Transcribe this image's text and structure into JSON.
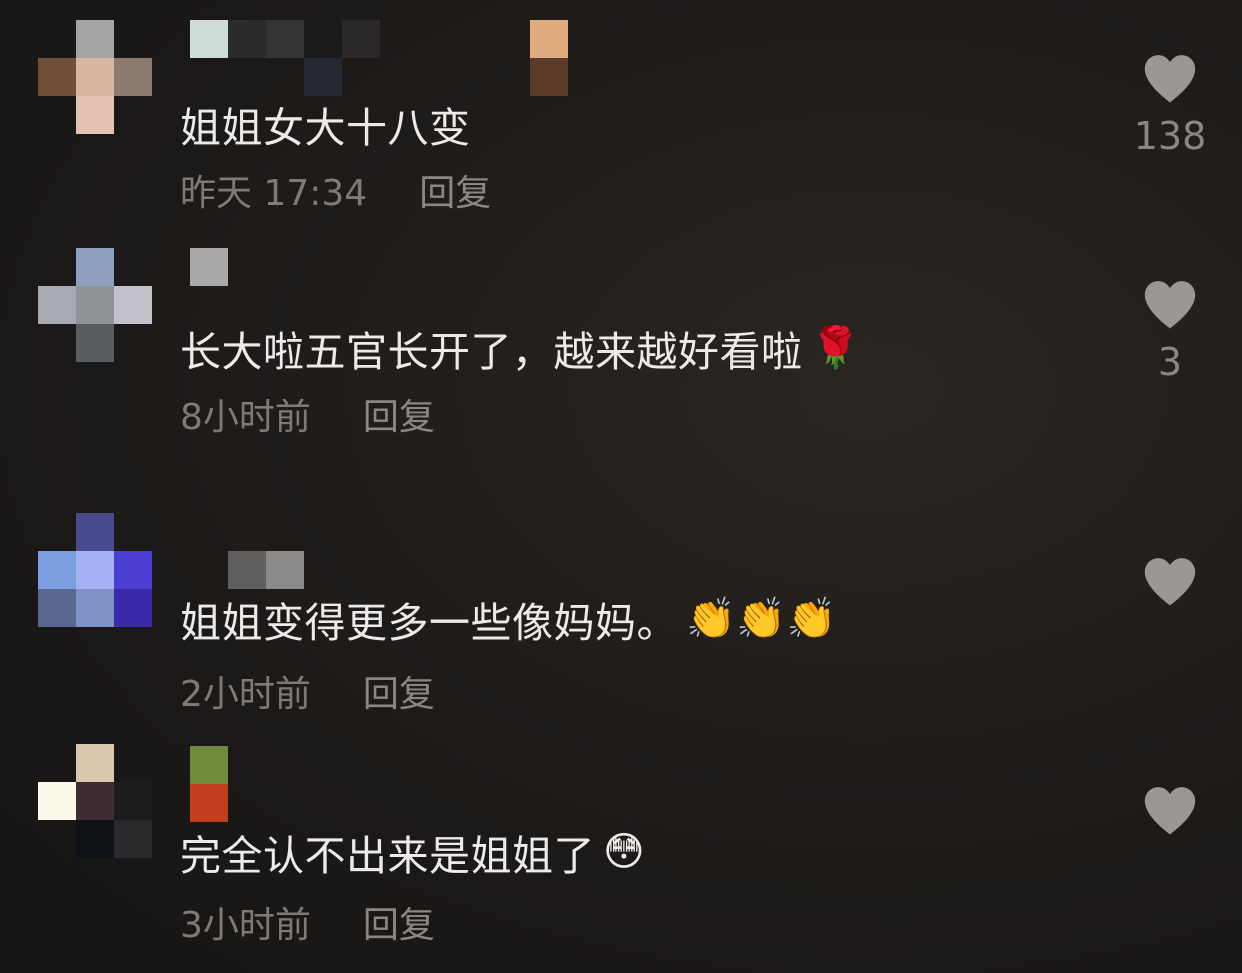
{
  "comments": [
    {
      "text": "姐姐女大十八变",
      "emoji": "",
      "time": "昨天 17:34",
      "reply": "回复",
      "likes": "138"
    },
    {
      "text": "长大啦五官长开了，越来越好看啦",
      "emoji": "🌹",
      "time": "8小时前",
      "reply": "回复",
      "likes": "3"
    },
    {
      "text": "姐姐变得更多一些像妈妈。",
      "emoji": "👏👏👏",
      "time": "2小时前",
      "reply": "回复",
      "likes": ""
    },
    {
      "text": "完全认不出来是姐姐了",
      "emoji": "😳",
      "time": "3小时前",
      "reply": "回复",
      "likes": ""
    }
  ],
  "colors": {
    "heart": "#9a9794",
    "text": "#ecebe9",
    "meta": "#7d7a77"
  },
  "icons": {
    "like": "heart-icon"
  }
}
